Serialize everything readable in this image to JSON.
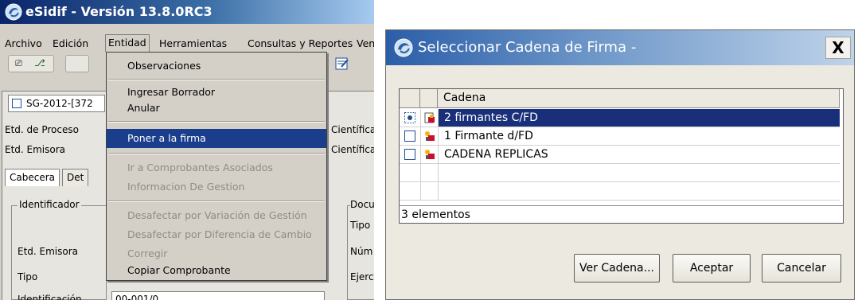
{
  "left_window": {
    "title": "eSidif - Versión 13.8.0RC3",
    "menu": [
      "Archivo",
      "Edición",
      "Entidad",
      "Herramientas",
      "Consultas y Reportes",
      "Vent"
    ],
    "document_tab": "SG-2012-[372",
    "labels": {
      "etd_proceso": "Etd. de Proceso",
      "etd_emisora": "Etd. Emisora",
      "cientifica_1": "Científica",
      "cientifica_2": "Científica",
      "identificador": "Identificador",
      "etd_emisora_2": "Etd. Emisora",
      "tipo": "Tipo",
      "identificacion": "Identificación",
      "doc": "Docu",
      "tipo_r": "Tipo",
      "num": "Núm",
      "ejer": "Ejerc"
    },
    "subtabs": [
      "Cabecera",
      "Det"
    ],
    "identificacion_value": "00-001/0",
    "dropdown": {
      "items": [
        {
          "label": "Observaciones",
          "enabled": true
        },
        {
          "label": "Ingresar Borrador",
          "enabled": true
        },
        {
          "label": "Anular",
          "enabled": true
        },
        {
          "label": "Poner a la firma",
          "enabled": true,
          "selected": true
        },
        {
          "label": "Ir a Comprobantes Asociados",
          "enabled": false
        },
        {
          "label": "Informacion De Gestion",
          "enabled": false
        },
        {
          "label": "Desafectar por Variación de Gestión",
          "enabled": false
        },
        {
          "label": "Desafectar por Diferencia de Cambio",
          "enabled": false
        },
        {
          "label": "Corregir",
          "enabled": false
        },
        {
          "label": "Copiar Comprobante",
          "enabled": true
        }
      ]
    }
  },
  "dialog": {
    "title": "Seleccionar Cadena de Firma -",
    "close_label": "X",
    "table": {
      "column_header": "Cadena",
      "rows": [
        {
          "name": "2 firmantes C/FD",
          "selected": true
        },
        {
          "name": "1 Firmante d/FD",
          "selected": false
        },
        {
          "name": "CADENA REPLICAS",
          "selected": false
        }
      ],
      "status": "3 elementos"
    },
    "buttons": {
      "ver_cadena": "Ver Cadena...",
      "aceptar": "Aceptar",
      "cancelar": "Cancelar"
    }
  },
  "colors": {
    "selection": "#1a2f7a",
    "title_gradient_start": "#0a246a"
  }
}
